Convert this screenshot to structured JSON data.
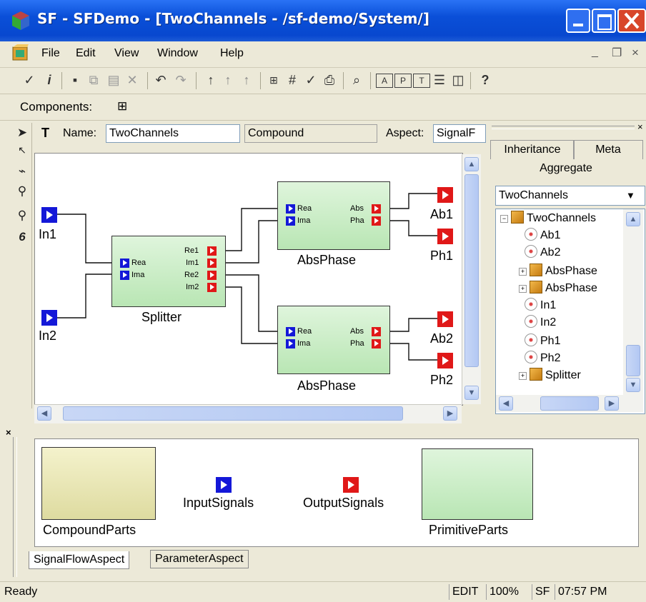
{
  "window": {
    "title": "SF - SFDemo - [TwoChannels - /sf-demo/System/]"
  },
  "menu": [
    "File",
    "Edit",
    "View",
    "Window",
    "Help"
  ],
  "mdi_controls": {
    "minimize": "_",
    "restore": "❐",
    "close": "×"
  },
  "components": {
    "label": "Components:"
  },
  "name_bar": {
    "name_label": "Name:",
    "name_value": "TwoChannels",
    "kind_value": "Compound",
    "aspect_label": "Aspect:",
    "aspect_value": "SignalF"
  },
  "palette_icons": [
    "pointer-icon",
    "zoom-icon",
    "connect-icon",
    "disconnect-icon",
    "magnifier-icon",
    "set-icon"
  ],
  "diagram": {
    "inputs": [
      {
        "label": "In1"
      },
      {
        "label": "In2"
      }
    ],
    "outputs": [
      {
        "label": "Ab1"
      },
      {
        "label": "Ph1"
      },
      {
        "label": "Ab2"
      },
      {
        "label": "Ph2"
      }
    ],
    "splitter": {
      "label": "Splitter",
      "in_ports": [
        "Rea",
        "Ima"
      ],
      "out_ports": [
        "Re1",
        "Im1",
        "Re2",
        "Im2"
      ]
    },
    "absphase": [
      {
        "label": "AbsPhase",
        "in_ports": [
          "Rea",
          "Ima"
        ],
        "out_ports": [
          "Abs",
          "Pha"
        ]
      },
      {
        "label": "AbsPhase",
        "in_ports": [
          "Rea",
          "Ima"
        ],
        "out_ports": [
          "Abs",
          "Pha"
        ]
      }
    ]
  },
  "browser": {
    "tabs": [
      "Inheritance",
      "Meta",
      "Aggregate"
    ],
    "combo_value": "TwoChannels",
    "tree": [
      {
        "label": "TwoChannels",
        "kind": "model",
        "expander": "−",
        "level": 0
      },
      {
        "label": "Ab1",
        "kind": "atom",
        "expander": "",
        "level": 1
      },
      {
        "label": "Ab2",
        "kind": "atom",
        "expander": "",
        "level": 1
      },
      {
        "label": "AbsPhase",
        "kind": "model",
        "expander": "+",
        "level": 1
      },
      {
        "label": "AbsPhase",
        "kind": "model",
        "expander": "+",
        "level": 1
      },
      {
        "label": "In1",
        "kind": "atom",
        "expander": "",
        "level": 1
      },
      {
        "label": "In2",
        "kind": "atom",
        "expander": "",
        "level": 1
      },
      {
        "label": "Ph1",
        "kind": "atom",
        "expander": "",
        "level": 1
      },
      {
        "label": "Ph2",
        "kind": "atom",
        "expander": "",
        "level": 1
      },
      {
        "label": "Splitter",
        "kind": "model",
        "expander": "+",
        "level": 1
      }
    ]
  },
  "part_browser": {
    "parts": [
      {
        "label": "CompoundParts"
      },
      {
        "label": "InputSignals"
      },
      {
        "label": "OutputSignals"
      },
      {
        "label": "PrimitiveParts"
      }
    ],
    "tabs": [
      "SignalFlowAspect",
      "ParameterAspect"
    ]
  },
  "status": {
    "text": "Ready",
    "mode": "EDIT",
    "zoom": "100%",
    "paradigm": "SF",
    "time": "07:57 PM"
  },
  "colors": {
    "title_bar": "#0a4fd8",
    "input_port": "#1418d8",
    "output_port": "#e01818",
    "primitive_fill": "#c6ecc2",
    "compound_fill": "#ece9b0"
  }
}
